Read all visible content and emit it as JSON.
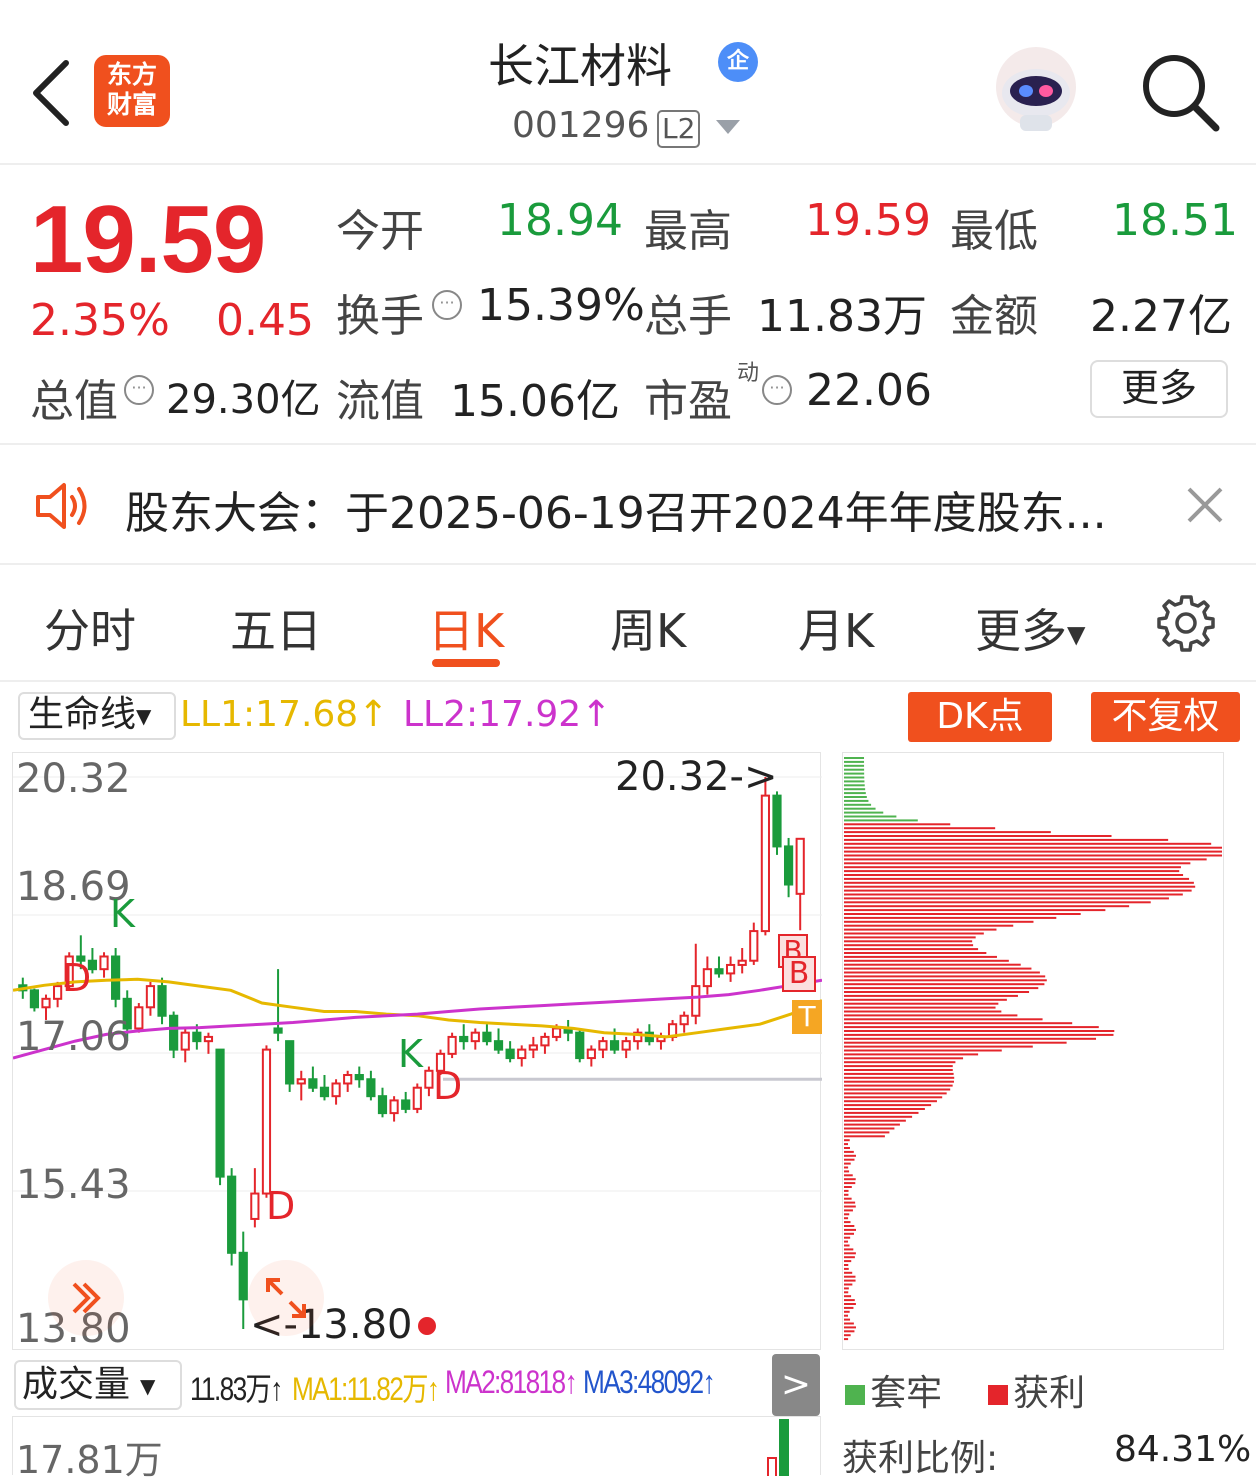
{
  "header": {
    "logo_line1": "东方",
    "logo_line2": "财富",
    "stock_name": "长江材料",
    "badge": "企",
    "stock_code": "001296",
    "level": "L2"
  },
  "quote": {
    "price": "19.59",
    "change_pct": "2.35%",
    "change": "0.45",
    "open_label": "今开",
    "open": "18.94",
    "high_label": "最高",
    "high": "19.59",
    "low_label": "最低",
    "low": "18.51",
    "turnover_label": "换手",
    "turnover": "15.39%",
    "volume_label": "总手",
    "volume": "11.83万",
    "amount_label": "金额",
    "amount": "2.27亿",
    "mktcap_label": "总值",
    "mktcap": "29.30亿",
    "float_label": "流值",
    "float_cap": "15.06亿",
    "pe_label": "市盈",
    "pe_sup": "动",
    "pe": "22.06",
    "more": "更多"
  },
  "notice": {
    "text": "股东大会：于2025-06-19召开2024年年度股东..."
  },
  "tabs": [
    "分时",
    "五日",
    "日K",
    "周K",
    "月K",
    "更多"
  ],
  "active_tab": "日K",
  "indicator": {
    "name": "生命线",
    "ll1": "LL1:17.68↑",
    "ll2": "LL2:17.92↑",
    "dk_button": "DK点",
    "adjust_button": "不复权"
  },
  "kline": {
    "y_labels": [
      "20.32",
      "18.69",
      "17.06",
      "15.43",
      "13.80"
    ],
    "max_marker": "20.32->",
    "min_marker": "<-13.80",
    "signals": {
      "k1": "K",
      "d1": "D",
      "k2": "K",
      "d2": "D",
      "d3": "D",
      "b1": "B",
      "b2": "B",
      "t1": "T"
    }
  },
  "volume": {
    "selector": "成交量",
    "value": "11.83万↑",
    "ma1": "MA1:11.82万↑",
    "ma2": "MA2:81818↑",
    "ma3": "MA3:48092↑",
    "y_label": "17.81万"
  },
  "profile": {
    "legend_trapped": "套牢",
    "legend_profit": "获利",
    "ratio_label": "获利比例:",
    "ratio_value": "84.31%"
  },
  "colors": {
    "up": "#e4252b",
    "down": "#1a9b3c",
    "accent": "#f0501e",
    "ll1": "#e6b800",
    "ll2": "#cc33cc"
  },
  "chart_data": {
    "type": "candlestick",
    "ylim": [
      13.8,
      20.32
    ],
    "candles": [
      [
        17.86,
        17.95,
        17.7,
        17.8
      ],
      [
        17.8,
        17.82,
        17.55,
        17.6
      ],
      [
        17.6,
        17.75,
        17.45,
        17.7
      ],
      [
        17.7,
        17.9,
        17.6,
        17.85
      ],
      [
        17.85,
        18.25,
        17.8,
        18.2
      ],
      [
        18.2,
        18.45,
        18.05,
        18.15
      ],
      [
        18.15,
        18.3,
        18.0,
        18.05
      ],
      [
        18.05,
        18.25,
        17.95,
        18.2
      ],
      [
        18.2,
        18.3,
        17.6,
        17.7
      ],
      [
        17.7,
        17.8,
        17.2,
        17.35
      ],
      [
        17.35,
        17.65,
        17.3,
        17.6
      ],
      [
        17.6,
        17.9,
        17.5,
        17.85
      ],
      [
        17.85,
        17.95,
        17.4,
        17.5
      ],
      [
        17.5,
        17.55,
        17.0,
        17.1
      ],
      [
        17.1,
        17.35,
        16.95,
        17.3
      ],
      [
        17.3,
        17.4,
        17.1,
        17.2
      ],
      [
        17.2,
        17.3,
        17.05,
        17.25
      ],
      [
        17.1,
        17.1,
        15.5,
        15.6
      ],
      [
        15.6,
        15.7,
        14.55,
        14.7
      ],
      [
        14.7,
        14.95,
        13.8,
        14.15
      ],
      [
        15.1,
        15.7,
        15.0,
        15.4
      ],
      [
        15.4,
        17.15,
        15.35,
        17.1
      ],
      [
        17.35,
        18.05,
        17.2,
        17.3
      ],
      [
        17.2,
        17.2,
        16.6,
        16.7
      ],
      [
        16.7,
        16.85,
        16.5,
        16.75
      ],
      [
        16.75,
        16.9,
        16.6,
        16.65
      ],
      [
        16.65,
        16.8,
        16.5,
        16.55
      ],
      [
        16.55,
        16.75,
        16.45,
        16.7
      ],
      [
        16.7,
        16.85,
        16.6,
        16.8
      ],
      [
        16.8,
        16.9,
        16.65,
        16.75
      ],
      [
        16.75,
        16.85,
        16.5,
        16.55
      ],
      [
        16.55,
        16.65,
        16.3,
        16.35
      ],
      [
        16.35,
        16.55,
        16.25,
        16.5
      ],
      [
        16.5,
        16.6,
        16.35,
        16.4
      ],
      [
        16.4,
        16.7,
        16.35,
        16.65
      ],
      [
        16.65,
        16.9,
        16.55,
        16.85
      ],
      [
        16.85,
        17.1,
        16.8,
        17.05
      ],
      [
        17.05,
        17.3,
        17.0,
        17.25
      ],
      [
        17.25,
        17.4,
        17.1,
        17.2
      ],
      [
        17.2,
        17.35,
        17.1,
        17.3
      ],
      [
        17.3,
        17.4,
        17.15,
        17.2
      ],
      [
        17.2,
        17.35,
        17.05,
        17.1
      ],
      [
        17.1,
        17.2,
        16.95,
        17.0
      ],
      [
        17.0,
        17.15,
        16.9,
        17.1
      ],
      [
        17.1,
        17.25,
        17.0,
        17.15
      ],
      [
        17.15,
        17.3,
        17.05,
        17.25
      ],
      [
        17.25,
        17.4,
        17.2,
        17.35
      ],
      [
        17.35,
        17.45,
        17.2,
        17.3
      ],
      [
        17.3,
        17.35,
        16.95,
        17.0
      ],
      [
        17.0,
        17.15,
        16.9,
        17.1
      ],
      [
        17.1,
        17.25,
        17.0,
        17.2
      ],
      [
        17.2,
        17.35,
        17.05,
        17.1
      ],
      [
        17.1,
        17.25,
        17.0,
        17.2
      ],
      [
        17.2,
        17.35,
        17.1,
        17.3
      ],
      [
        17.3,
        17.4,
        17.15,
        17.2
      ],
      [
        17.2,
        17.3,
        17.1,
        17.25
      ],
      [
        17.25,
        17.45,
        17.2,
        17.4
      ],
      [
        17.4,
        17.55,
        17.3,
        17.5
      ],
      [
        17.5,
        18.35,
        17.4,
        17.85
      ],
      [
        17.85,
        18.2,
        17.75,
        18.05
      ],
      [
        18.05,
        18.2,
        17.95,
        18.0
      ],
      [
        18.0,
        18.2,
        17.9,
        18.1
      ],
      [
        18.1,
        18.3,
        18.0,
        18.15
      ],
      [
        18.15,
        18.6,
        18.1,
        18.5
      ],
      [
        18.5,
        20.32,
        18.45,
        20.1
      ],
      [
        20.1,
        20.15,
        19.4,
        19.5
      ],
      [
        19.5,
        19.6,
        18.9,
        19.05
      ],
      [
        18.94,
        19.59,
        18.51,
        19.59
      ]
    ],
    "ll1_line": [
      17.8,
      17.86,
      17.9,
      17.92,
      17.93,
      17.9,
      17.85,
      17.8,
      17.65,
      17.6,
      17.55,
      17.55,
      17.52,
      17.5,
      17.45,
      17.42,
      17.4,
      17.38,
      17.35,
      17.3,
      17.28,
      17.25,
      17.3,
      17.35,
      17.4,
      17.52,
      17.68
    ],
    "ll2_line": [
      17.0,
      17.1,
      17.2,
      17.28,
      17.32,
      17.35,
      17.36,
      17.38,
      17.4,
      17.42,
      17.45,
      17.48,
      17.5,
      17.52,
      17.55,
      17.58,
      17.6,
      17.62,
      17.64,
      17.66,
      17.68,
      17.7,
      17.72,
      17.75,
      17.8,
      17.86,
      17.92
    ]
  }
}
